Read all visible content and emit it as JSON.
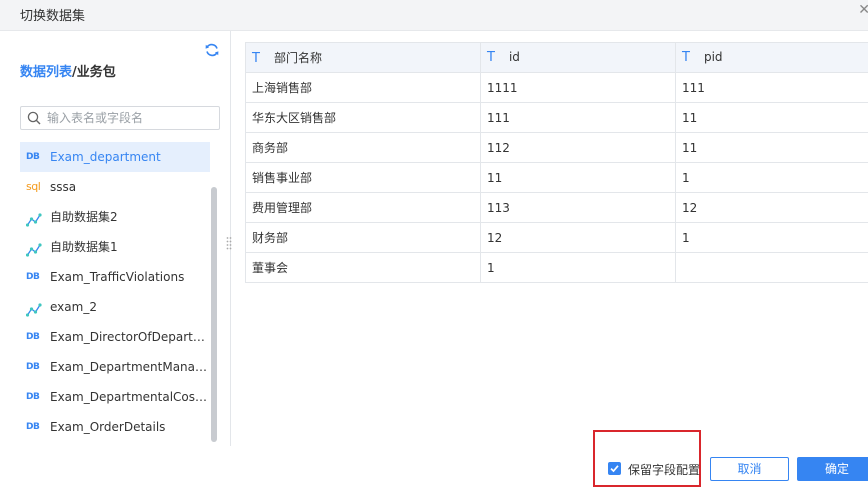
{
  "dialog": {
    "title": "切换数据集"
  },
  "left": {
    "title_part1": "数据列表",
    "title_part2": "/业务包",
    "search_placeholder": "输入表名或字段名",
    "items": [
      {
        "icon": "db-icon",
        "label": "Exam_department",
        "selected": true
      },
      {
        "icon": "sql-icon",
        "label": "sssa"
      },
      {
        "icon": "self-service-dataset-icon",
        "label": "自助数据集2"
      },
      {
        "icon": "self-service-dataset-icon",
        "label": "自助数据集1"
      },
      {
        "icon": "db-icon",
        "label": "Exam_TrafficViolations"
      },
      {
        "icon": "self-service-dataset-icon",
        "label": "exam_2"
      },
      {
        "icon": "db-icon",
        "label": "Exam_DirectorOfDepartme..."
      },
      {
        "icon": "db-icon",
        "label": "Exam_DepartmentManager..."
      },
      {
        "icon": "db-icon",
        "label": "Exam_DepartmentalCostSt..."
      },
      {
        "icon": "db-icon",
        "label": "Exam_OrderDetails"
      }
    ]
  },
  "icon_text": {
    "db": "DB",
    "sql": "sql",
    "field_type": "T"
  },
  "table": {
    "columns": [
      "部门名称",
      "id",
      "pid"
    ],
    "rows": [
      [
        "上海销售部",
        "1111",
        "111"
      ],
      [
        "华东大区销售部",
        "111",
        "11"
      ],
      [
        "商务部",
        "112",
        "11"
      ],
      [
        "销售事业部",
        "11",
        "1"
      ],
      [
        "费用管理部",
        "113",
        "12"
      ],
      [
        "财务部",
        "12",
        "1"
      ],
      [
        "董事会",
        "1",
        ""
      ]
    ]
  },
  "footer": {
    "keep_config_label": "保留字段配置",
    "keep_config_checked": true,
    "cancel_label": "取消",
    "ok_label": "确定"
  },
  "colors": {
    "accent": "#3685f2",
    "sql": "#f49a1b",
    "highlight": "#d9262c"
  }
}
